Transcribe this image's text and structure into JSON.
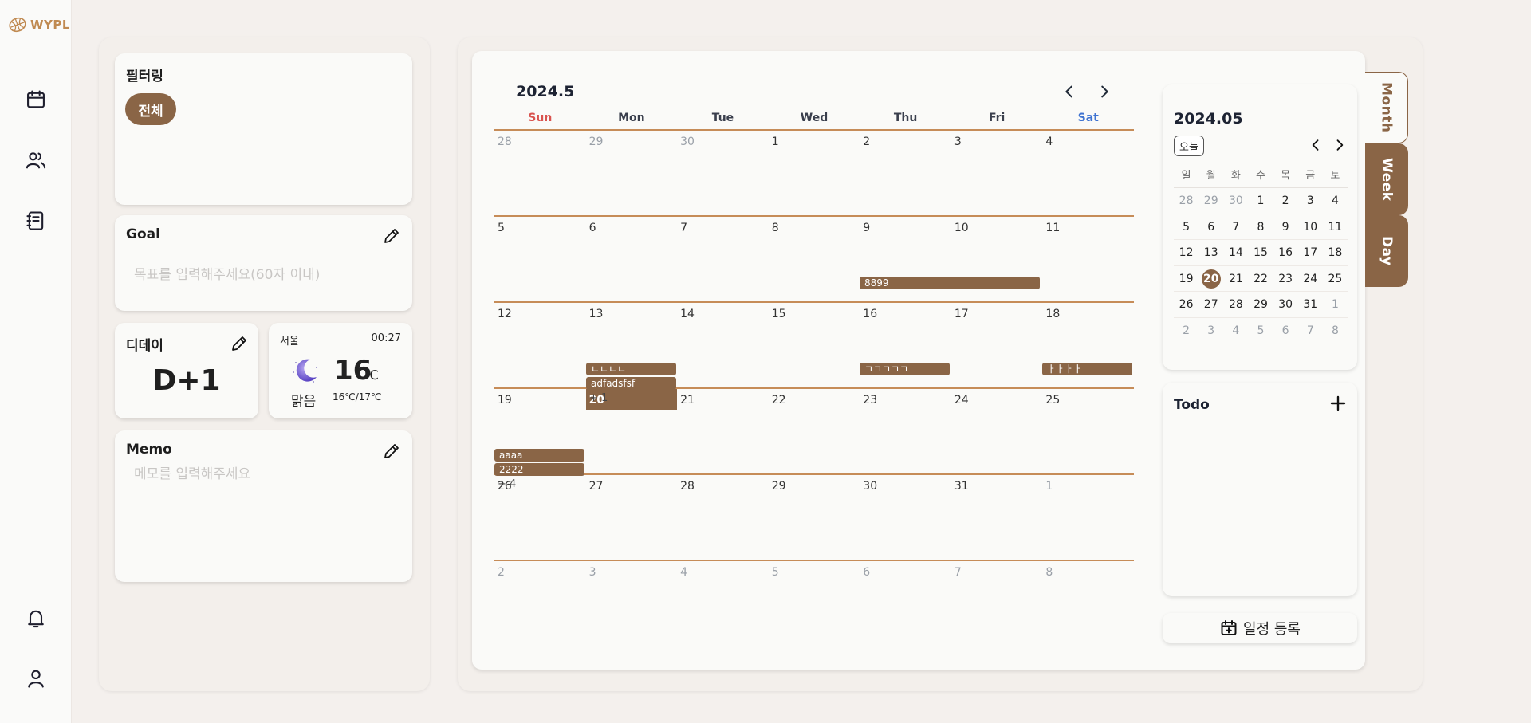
{
  "app": {
    "logo_text": "WYPL"
  },
  "nav": {
    "items": [
      "calendar-icon",
      "users-icon",
      "notebook-icon"
    ],
    "bottom": [
      "bell-icon",
      "user-icon"
    ]
  },
  "filter": {
    "title": "필터링",
    "chip": "전체"
  },
  "goal": {
    "title": "Goal",
    "placeholder": "목표를 입력해주세요(60자 이내)"
  },
  "dday": {
    "title": "디데이",
    "value": "D+1"
  },
  "weather": {
    "city": "서울",
    "time": "00:27",
    "temp": "16",
    "unit": "℃",
    "condition": "맑음",
    "range": "16℃/17℃",
    "icon": "moon-icon"
  },
  "memo": {
    "title": "Memo",
    "placeholder": "메모를 입력해주세요"
  },
  "calendar": {
    "title": "2024.5",
    "weekdays": [
      "Sun",
      "Mon",
      "Tue",
      "Wed",
      "Thu",
      "Fri",
      "Sat"
    ],
    "weeks": [
      [
        "28",
        "29",
        "30",
        "1",
        "2",
        "3",
        "4"
      ],
      [
        "5",
        "6",
        "7",
        "8",
        "9",
        "10",
        "11"
      ],
      [
        "12",
        "13",
        "14",
        "15",
        "16",
        "17",
        "18"
      ],
      [
        "19",
        "20",
        "21",
        "22",
        "23",
        "24",
        "25"
      ],
      [
        "26",
        "27",
        "28",
        "29",
        "30",
        "31",
        "1"
      ],
      [
        "2",
        "3",
        "4",
        "5",
        "6",
        "7",
        "8"
      ]
    ],
    "events": {
      "e1": "8899",
      "e2": "ㄴㄴㄴㄴ",
      "e3": "adfadsfsf",
      "e4": "ㄱㄱㄱㄱㄱ",
      "e5": "ㅏㅏㅏㅏ",
      "e6": "aaaa",
      "e7": "2222"
    },
    "more": {
      "m1": "+ 1",
      "m2": "+ 4"
    }
  },
  "mini": {
    "title": "2024.05",
    "today_label": "오늘",
    "weekdays": [
      "일",
      "월",
      "화",
      "수",
      "목",
      "금",
      "토"
    ],
    "weeks": [
      [
        "28",
        "29",
        "30",
        "1",
        "2",
        "3",
        "4"
      ],
      [
        "5",
        "6",
        "7",
        "8",
        "9",
        "10",
        "11"
      ],
      [
        "12",
        "13",
        "14",
        "15",
        "16",
        "17",
        "18"
      ],
      [
        "19",
        "20",
        "21",
        "22",
        "23",
        "24",
        "25"
      ],
      [
        "26",
        "27",
        "28",
        "29",
        "30",
        "31",
        "1"
      ],
      [
        "2",
        "3",
        "4",
        "5",
        "6",
        "7",
        "8"
      ]
    ]
  },
  "todo": {
    "title": "Todo"
  },
  "register": {
    "label": "일정 등록"
  },
  "view_tabs": {
    "month": "Month",
    "week": "Week",
    "day": "Day"
  },
  "colors": {
    "accent": "#8a6546",
    "grid_line": "#c68c58",
    "sunday": "#d9534f",
    "saturday": "#3f73d1"
  }
}
